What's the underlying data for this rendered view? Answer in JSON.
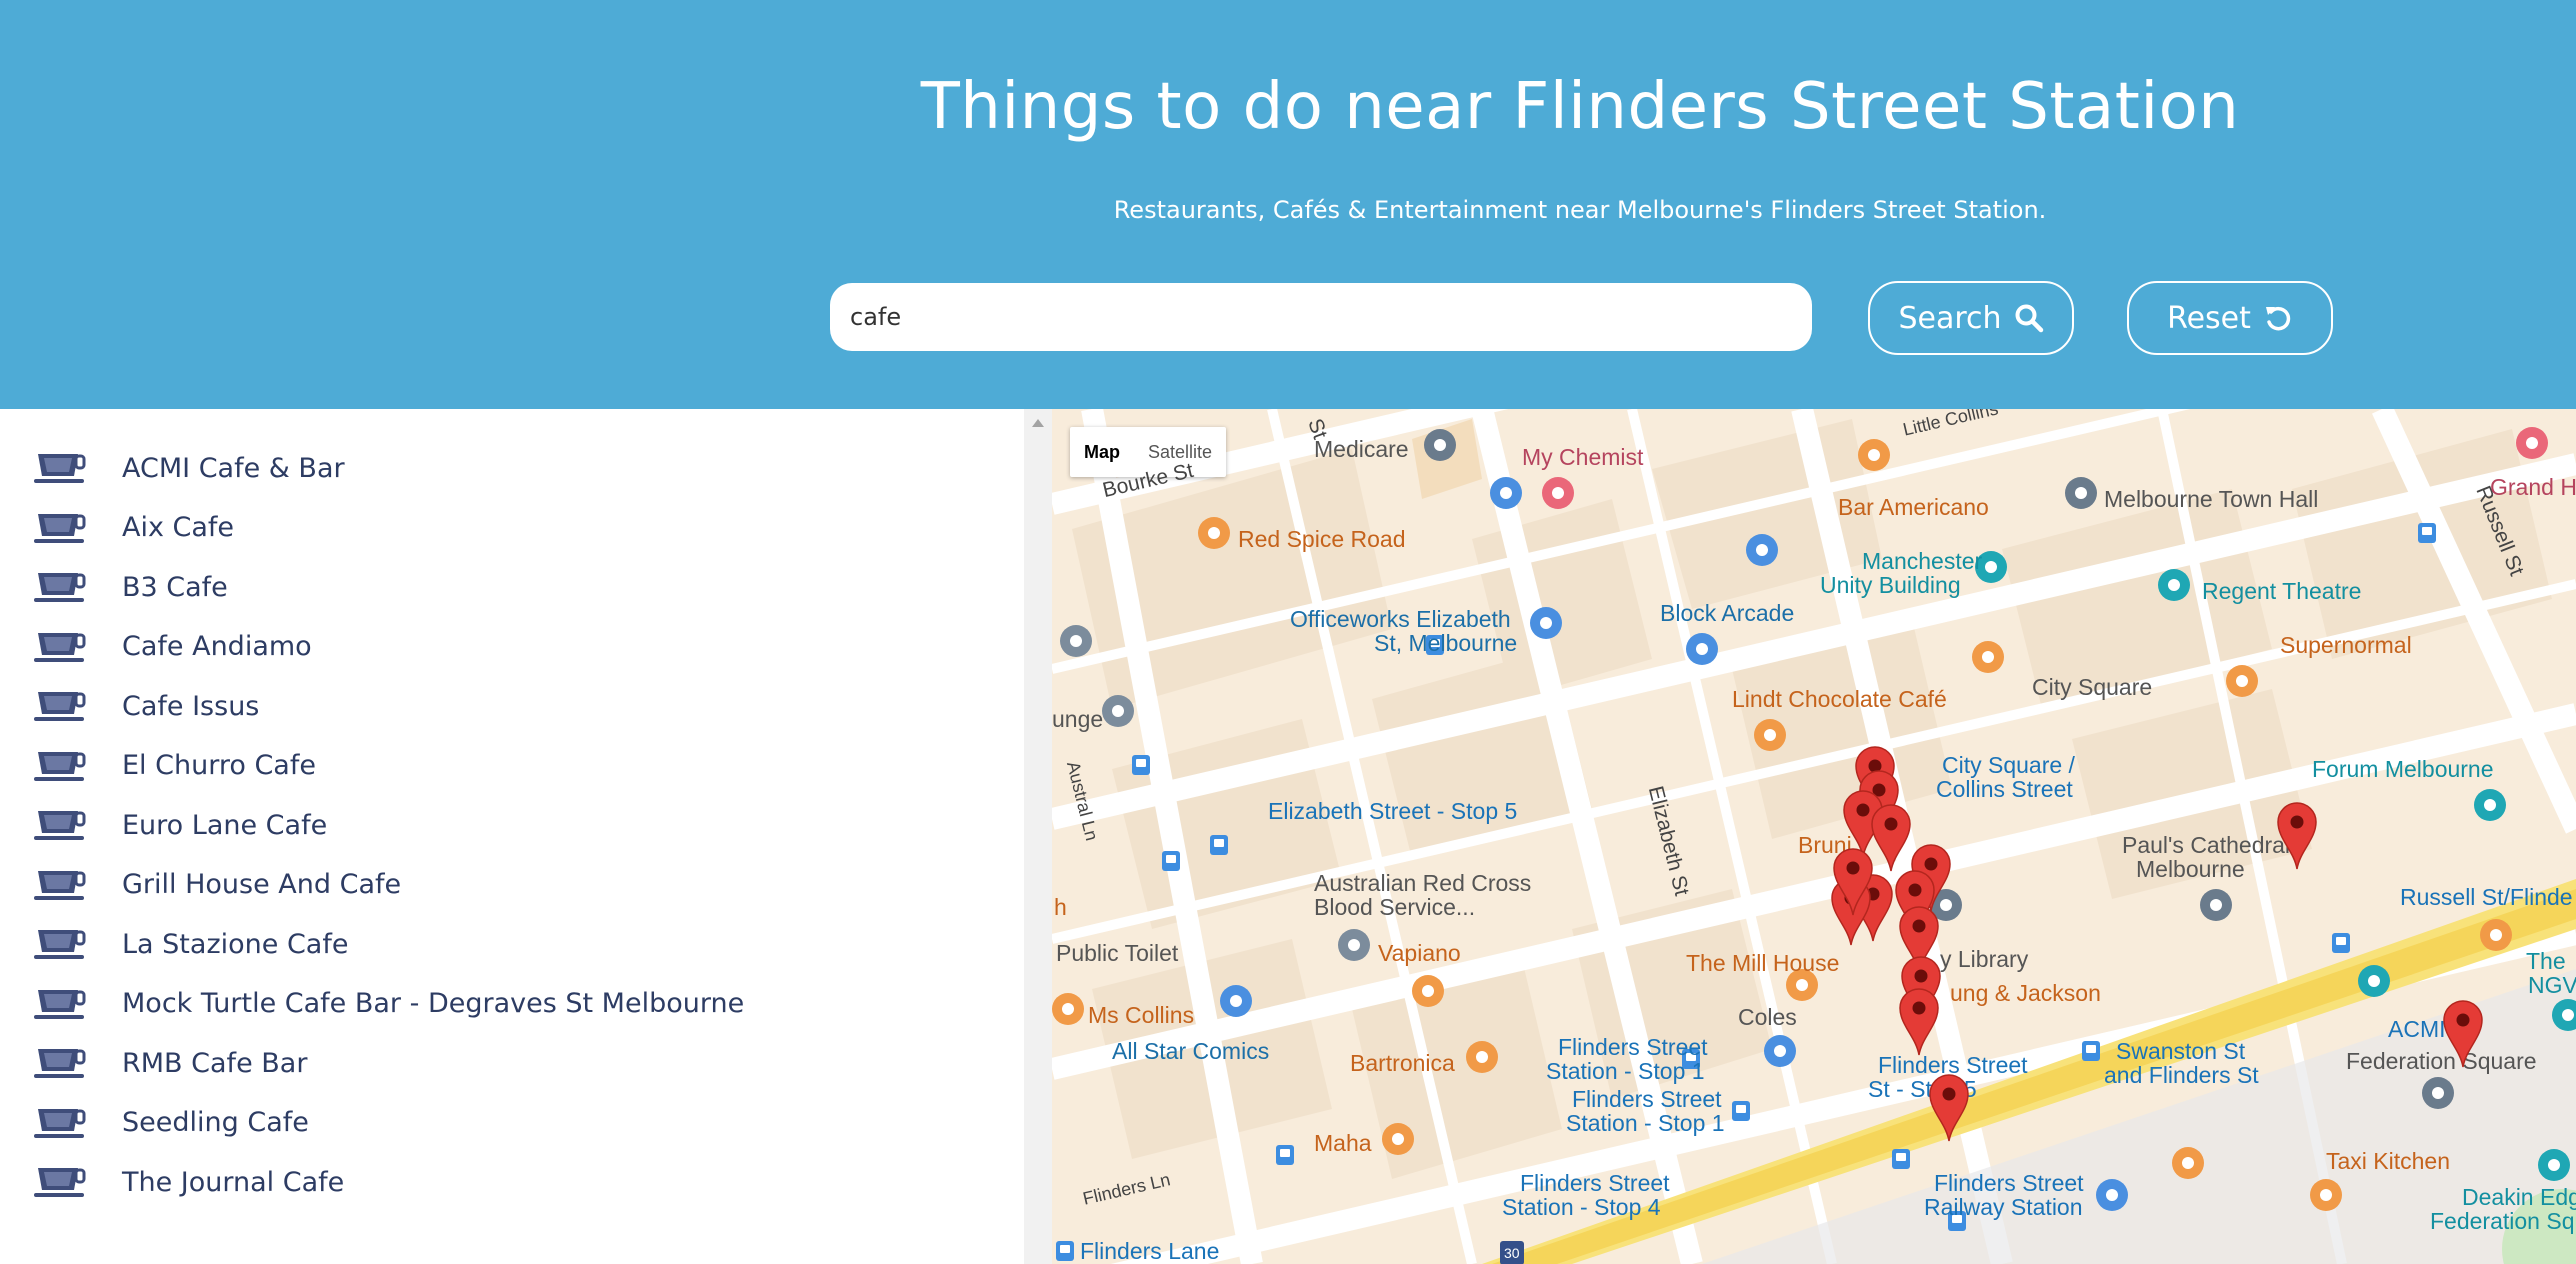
{
  "header": {
    "title": "Things to do near Flinders Street Station",
    "subtitle": "Restaurants, Cafés & Entertainment near Melbourne's Flinders Street Station.",
    "search_value": "cafe",
    "search_button": "Search",
    "reset_button": "Reset"
  },
  "colors": {
    "header_bg": "#4eabd6",
    "list_text": "#2d3c63",
    "pin": "#e43b36"
  },
  "results": [
    {
      "label": "ACMI Cafe & Bar"
    },
    {
      "label": "Aix Cafe"
    },
    {
      "label": "B3 Cafe"
    },
    {
      "label": "Cafe Andiamo"
    },
    {
      "label": "Cafe Issus"
    },
    {
      "label": "El Churro Cafe"
    },
    {
      "label": "Euro Lane Cafe"
    },
    {
      "label": "Grill House And Cafe"
    },
    {
      "label": "La Stazione Cafe"
    },
    {
      "label": "Mock Turtle Cafe Bar - Degraves St Melbourne"
    },
    {
      "label": "RMB Cafe Bar"
    },
    {
      "label": "Seedling Cafe"
    },
    {
      "label": "The Journal Cafe"
    }
  ],
  "result_icon": "coffee-cup-icon",
  "map": {
    "type_control": {
      "map": "Map",
      "satellite": "Satellite"
    },
    "labels": {
      "medicare": "Medicare",
      "my_chemist": "My Chemist",
      "bar_americano": "Bar Americano",
      "melbourne_town_hall": "Melbourne Town Hall",
      "grand_h": "Grand H",
      "red_spice_road": "Red Spice Road",
      "manchester_unity_1": "Manchester",
      "manchester_unity_2": "Unity Building",
      "regent_theatre": "Regent Theatre",
      "officeworks_1": "Officeworks Elizabeth",
      "officeworks_2": "St, Melbourne",
      "block_arcade": "Block Arcade",
      "supernormal": "Supernormal",
      "city_square": "City Square",
      "lounge": "unge",
      "lindt": "Lindt Chocolate Café",
      "city_square_collins_1": "City Square /",
      "city_square_collins_2": "Collins Street",
      "forum_melbourne": "Forum Melbourne",
      "elizabeth_stop5": "Elizabeth Street - Stop 5",
      "bruni": "Bruni",
      "pauls_1": "Paul's Cathedral,",
      "pauls_2": "Melbourne",
      "red_cross_1": "Australian Red Cross",
      "red_cross_2": "Blood Service...",
      "russell_flinders": "Russell St/Flinde",
      "public_toilet": "Public Toilet",
      "vapiano": "Vapiano",
      "mill_house": "The Mill House",
      "library": "y Library",
      "the_ngv_1": "The",
      "the_ngv_2": "NGV",
      "ms_collins": "Ms Collins",
      "young_jackson": "ung & Jackson",
      "acmi": "ACMI",
      "all_star": "All Star Comics",
      "coles": "Coles",
      "swanston_1": "Swanston St",
      "swanston_2": "and Flinders St",
      "federation_square": "Federation Square",
      "bartronica": "Bartronica",
      "fss_stop1a_1": "Flinders Street",
      "fss_stop1a_2": "Station - Stop 1",
      "fss_stop1b_1": "Flinders Street",
      "fss_stop1b_2": "Station - Stop 1",
      "fs_stop5_1": "Flinders Street",
      "fs_stop5_2": "St  - Stop 5",
      "maha": "Maha",
      "taxi_kitchen": "Taxi Kitchen",
      "fss_stop4_1": "Flinders Street",
      "fss_stop4_2": "Station - Stop 4",
      "fs_railway_1": "Flinders Street",
      "fs_railway_2": "Railway Station",
      "deakin_1": "Deakin Edge",
      "deakin_2": "Federation Square",
      "flinders_lane": "Flinders Lane",
      "h_partial": "h",
      "route_30": "30"
    },
    "streets": {
      "bourke": "Bourke St",
      "little_collins": "Little Collins",
      "russell": "Russell St",
      "elizabeth": "Elizabeth St",
      "austral": "Austral Ln",
      "flinders_ln": "Flinders Ln",
      "st": "St"
    },
    "pin_count": 15
  }
}
